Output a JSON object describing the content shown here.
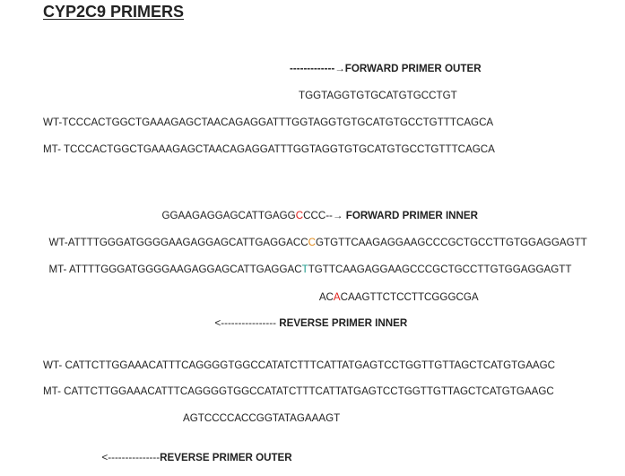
{
  "title": "CYP2C9 PRIMERS",
  "forward_outer_label": "-------------→FORWARD PRIMER OUTER",
  "forward_outer_seq": "TGGTAGGTGTGCATGTGCCTGT",
  "wt_block1": "WT-TCCCACTGGCTGAAAGAGCTAACAGAGGATTTGGTAGGTGTGCATGTGCCTGTTTCAGCA",
  "mt_block1": "MT- TCCCACTGGCTGAAAGAGCTAACAGAGGATTTGGTAGGTGTGCATGTGCCTGTTTCAGCA",
  "forward_inner": {
    "seq_before": "GGAAGAGGAGCATTGAGG",
    "seq_highlight": "C",
    "seq_after": "CCC--→ ",
    "label": "FORWARD PRIMER INNER"
  },
  "wt_block2": {
    "before": "WT-ATTTTGGGATGGGGAAGAGGAGCATTGAGGACC",
    "highlight": "C",
    "after": "GTGTTCAAGAGGAAGCCCGCTGCCTTGTGGAGGAGTT"
  },
  "mt_block2": {
    "before": "MT- ATTTTGGGATGGGGAAGAGGAGCATTGAGGAC",
    "highlight": "T",
    "after": "TGTTCAAGAGGAAGCCCGCTGCCTTGTGGAGGAGTT"
  },
  "reverse_inner_seq": {
    "before": "AC",
    "highlight": "A",
    "after": "CAAGTTCTCCTTCGGGCGA"
  },
  "reverse_inner_label": {
    "arrow": "<---------------- ",
    "label": "REVERSE PRIMER INNER"
  },
  "wt_block3": "WT- CATTCTTGGAAACATTTCAGGGGTGGCCATATCTTTCATTATGAGTCCTGGTTGTTAGCTCATGTGAAGC",
  "mt_block3": "MT- CATTCTTGGAAACATTTCAGGGGTGGCCATATCTTTCATTATGAGTCCTGGTTGTTAGCTCATGTGAAGC",
  "reverse_outer_seq": "AGTCCCCACCGGTATAGAAAGT",
  "reverse_outer_label": {
    "arrow": "<---------------",
    "label": "REVERSE PRIMER OUTER"
  },
  "colors": {
    "text": "#222222",
    "snp_red": "#e0201a",
    "snp_orange": "#e08a1a",
    "snp_teal": "#1a9a8a"
  }
}
